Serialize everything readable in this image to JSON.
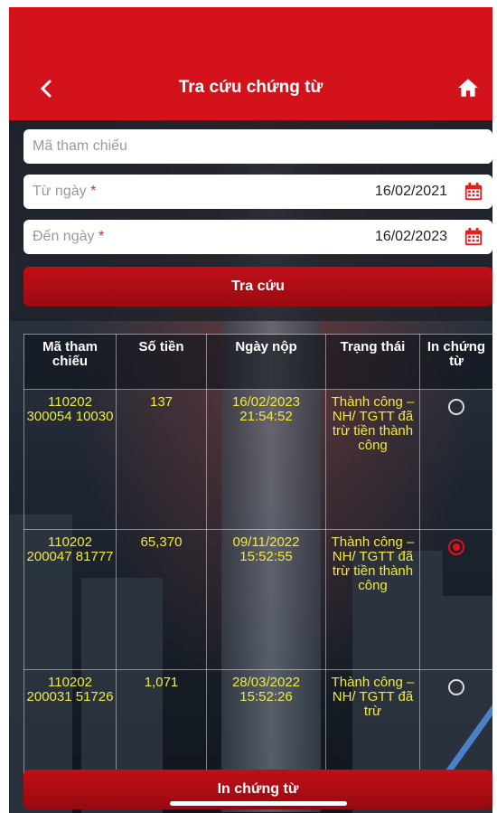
{
  "header": {
    "title": "Tra cứu chứng từ"
  },
  "form": {
    "ref_placeholder": "Mã tham chiếu",
    "from_label": "Từ ngày",
    "from_value": "16/02/2021",
    "to_label": "Đến ngày",
    "to_value": "16/02/2023",
    "required_mark": "*",
    "search_button": "Tra cứu"
  },
  "table": {
    "headers": [
      "Mã tham chiếu",
      "Số tiền",
      "Ngày nộp",
      "Trạng thái",
      "In chứng từ"
    ],
    "rows": [
      {
        "ref": "110202 300054 10030",
        "amount": "137",
        "date": "16/02/2023 21:54:52",
        "status": "Thành công – NH/ TGTT đã trừ tiền thành công",
        "selected": false
      },
      {
        "ref": "110202 200047 81777",
        "amount": "65,370",
        "date": "09/11/2022 15:52:55",
        "status": "Thành công – NH/ TGTT đã trừ tiền thành công",
        "selected": true
      },
      {
        "ref": "110202 200031 51726",
        "amount": "1,071",
        "date": "28/03/2022 15:52:26",
        "status": "Thành công – NH/ TGTT đã trừ",
        "selected": false
      }
    ]
  },
  "footer": {
    "print_button": "In chứng từ"
  },
  "colors": {
    "brand_red": "#d3121c",
    "cell_text": "#f2e93a"
  }
}
